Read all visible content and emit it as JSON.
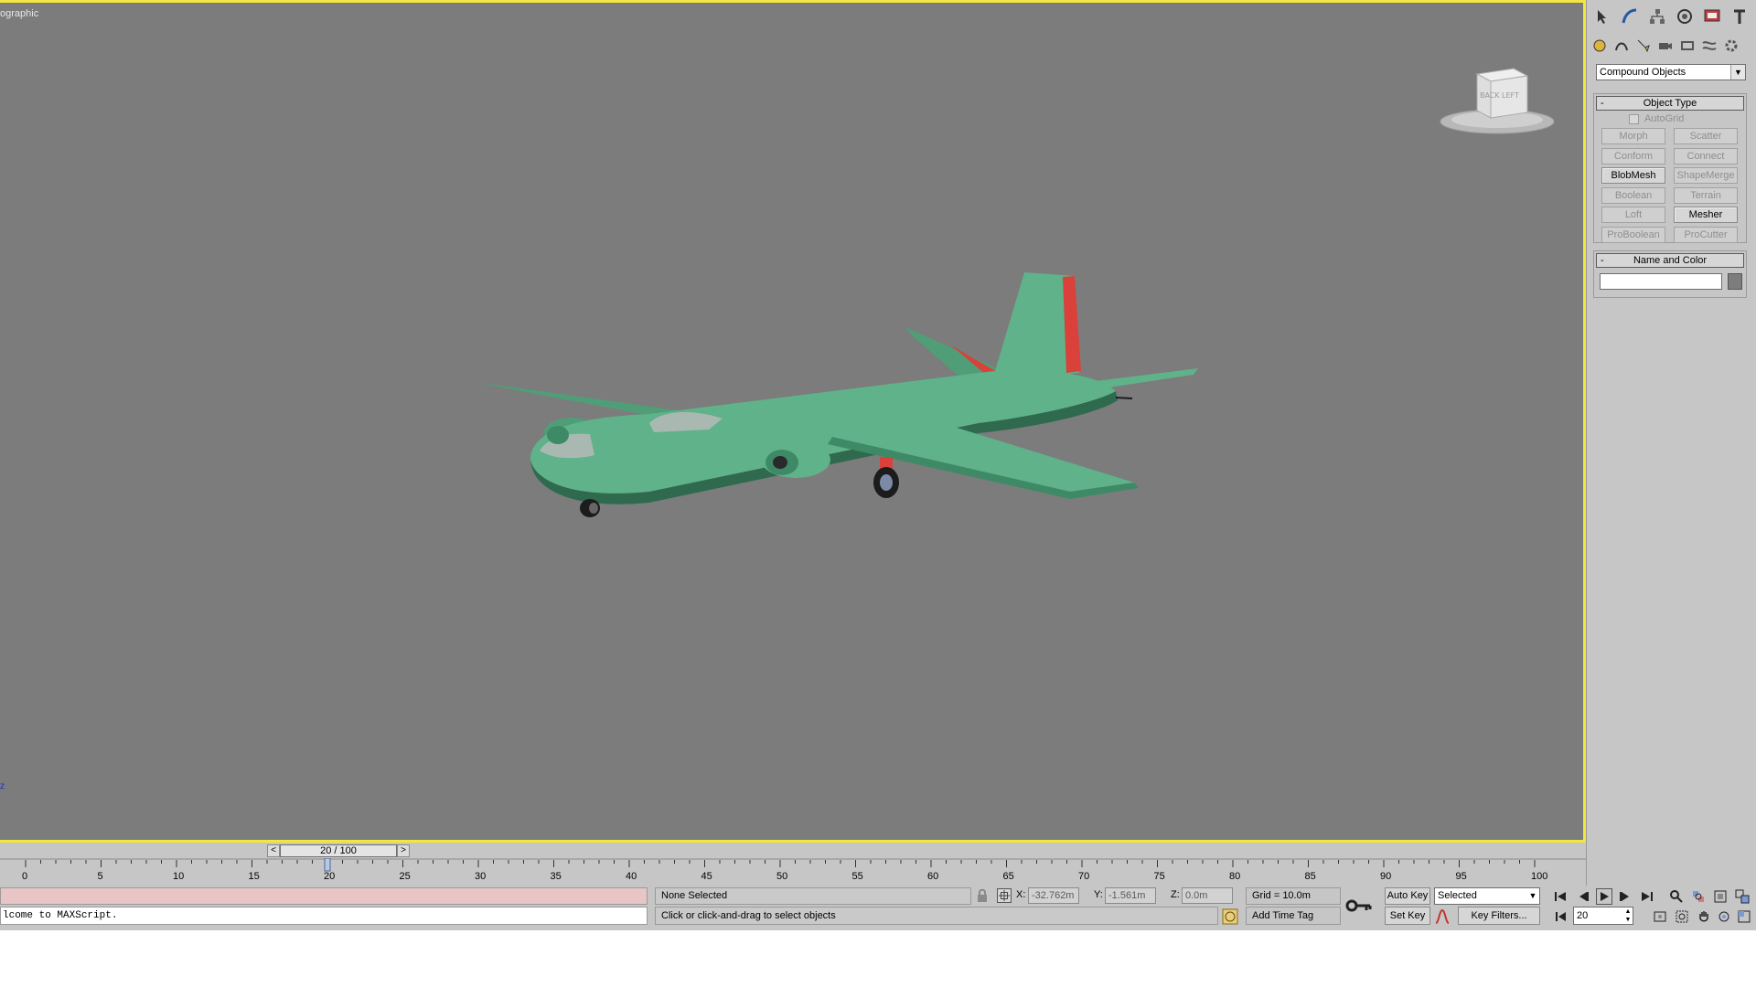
{
  "viewport": {
    "label": "ographic",
    "axis_label": "z",
    "viewcube": {
      "face_back": "BACK",
      "face_left": "LEFT"
    },
    "model_colors": {
      "body": "#5fb28a",
      "tail_accent": "#d9413a",
      "wheel": "#1c1c1c"
    }
  },
  "command_panel": {
    "top_tabs": [
      "select-icon",
      "create-curve-icon",
      "hierarchy-icon",
      "motion-icon",
      "display-icon",
      "utilities-icon"
    ],
    "sub_tabs": [
      "geometry-icon",
      "shapes-icon",
      "lights-icon",
      "cameras-icon",
      "helpers-icon",
      "spacewarps-icon",
      "systems-icon"
    ],
    "category": "Compound Objects",
    "object_type": {
      "title": "Object Type",
      "autogrid": "AutoGrid",
      "buttons": [
        {
          "label": "Morph",
          "enabled": false
        },
        {
          "label": "Scatter",
          "enabled": false
        },
        {
          "label": "Conform",
          "enabled": false
        },
        {
          "label": "Connect",
          "enabled": false
        },
        {
          "label": "BlobMesh",
          "enabled": true
        },
        {
          "label": "ShapeMerge",
          "enabled": false
        },
        {
          "label": "Boolean",
          "enabled": false
        },
        {
          "label": "Terrain",
          "enabled": false
        },
        {
          "label": "Loft",
          "enabled": false
        },
        {
          "label": "Mesher",
          "enabled": true
        },
        {
          "label": "ProBoolean",
          "enabled": false
        },
        {
          "label": "ProCutter",
          "enabled": false
        }
      ]
    },
    "name_and_color": {
      "title": "Name and Color",
      "name_value": "",
      "color": "#7d7d7d"
    }
  },
  "time_slider": {
    "position": "20 / 100",
    "prev": "<",
    "next": ">",
    "current_frame": 20,
    "total_frames": 100
  },
  "track_bar": {
    "ticks": [
      "0",
      "5",
      "10",
      "15",
      "20",
      "25",
      "30",
      "35",
      "40",
      "45",
      "50",
      "55",
      "60",
      "65",
      "70",
      "75",
      "80",
      "85",
      "90",
      "95",
      "100"
    ]
  },
  "status": {
    "maxscript_line": "lcome to MAXScript.",
    "selection": "None Selected",
    "prompt": "Click or click-and-drag to select objects",
    "x_label": "X:",
    "x_value": "-32.762m",
    "y_label": "Y:",
    "y_value": "-1.561m",
    "z_label": "Z:",
    "z_value": "0.0m",
    "grid": "Grid = 10.0m",
    "add_time_tag": "Add Time Tag",
    "auto_key": "Auto Key",
    "set_key": "Set Key",
    "key_mode": "Selected",
    "key_filters": "Key Filters...",
    "frame": "20"
  }
}
